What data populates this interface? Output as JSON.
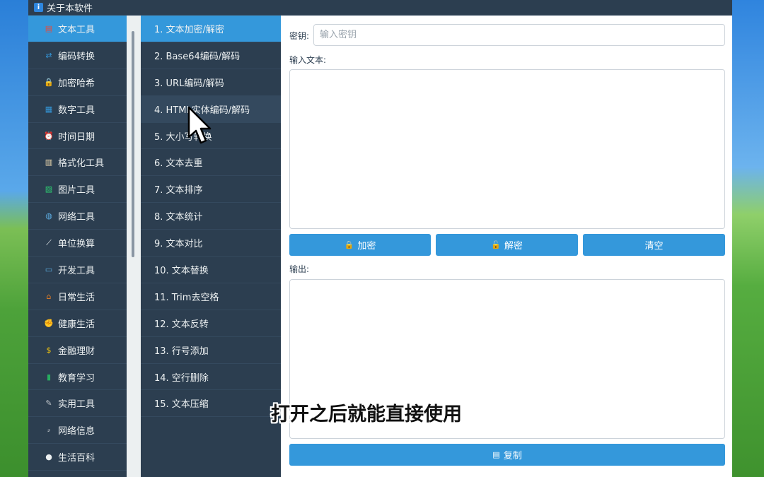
{
  "window": {
    "title": "关于本软件"
  },
  "categories": [
    {
      "label": "文本工具",
      "icon": "document-icon",
      "glyph": "▤",
      "color": "#e74c3c",
      "active": true
    },
    {
      "label": "编码转换",
      "icon": "convert-icon",
      "glyph": "⇄",
      "color": "#3498db"
    },
    {
      "label": "加密哈希",
      "icon": "lock-icon",
      "glyph": "🔒",
      "color": "#f1c40f"
    },
    {
      "label": "数字工具",
      "icon": "numbers-icon",
      "glyph": "▦",
      "color": "#3498db"
    },
    {
      "label": "时间日期",
      "icon": "alarm-clock-icon",
      "glyph": "⏰",
      "color": "#e74c3c"
    },
    {
      "label": "格式化工具",
      "icon": "clipboard-icon",
      "glyph": "▥",
      "color": "#f5deb3"
    },
    {
      "label": "图片工具",
      "icon": "image-icon",
      "glyph": "▨",
      "color": "#2ecc71"
    },
    {
      "label": "网络工具",
      "icon": "globe-icon",
      "glyph": "◍",
      "color": "#5dade2"
    },
    {
      "label": "单位换算",
      "icon": "ruler-icon",
      "glyph": "⟋",
      "color": "#ecf0f1"
    },
    {
      "label": "开发工具",
      "icon": "laptop-icon",
      "glyph": "▭",
      "color": "#5dade2"
    },
    {
      "label": "日常生活",
      "icon": "house-icon",
      "glyph": "⌂",
      "color": "#e67e22"
    },
    {
      "label": "健康生活",
      "icon": "muscle-icon",
      "glyph": "✊",
      "color": "#f1c40f"
    },
    {
      "label": "金融理财",
      "icon": "money-bag-icon",
      "glyph": "$",
      "color": "#f1c40f"
    },
    {
      "label": "教育学习",
      "icon": "books-icon",
      "glyph": "▮",
      "color": "#27ae60"
    },
    {
      "label": "实用工具",
      "icon": "tools-icon",
      "glyph": "✎",
      "color": "#bdc3c7"
    },
    {
      "label": "网络信息",
      "icon": "antenna-icon",
      "glyph": "⸗",
      "color": "#bdc3c7"
    },
    {
      "label": "生活百科",
      "icon": "bullet-icon",
      "glyph": "●",
      "color": "#ecf0f1"
    }
  ],
  "tools": [
    {
      "label": "1. 文本加密/解密",
      "active": true
    },
    {
      "label": "2. Base64编码/解码"
    },
    {
      "label": "3. URL编码/解码"
    },
    {
      "label": "4. HTML实体编码/解码",
      "hover": true
    },
    {
      "label": "5. 大小写转换"
    },
    {
      "label": "6. 文本去重"
    },
    {
      "label": "7. 文本排序"
    },
    {
      "label": "8. 文本统计"
    },
    {
      "label": "9. 文本对比"
    },
    {
      "label": "10. 文本替换"
    },
    {
      "label": "11. Trim去空格"
    },
    {
      "label": "12. 文本反转"
    },
    {
      "label": "13. 行号添加"
    },
    {
      "label": "14. 空行删除"
    },
    {
      "label": "15. 文本压缩"
    }
  ],
  "main": {
    "key_label": "密钥:",
    "key_placeholder": "输入密钥",
    "key_value": "",
    "input_label": "输入文本:",
    "input_value": "",
    "encrypt_label": "加密",
    "decrypt_label": "解密",
    "clear_label": "清空",
    "output_label": "输出:",
    "output_value": "",
    "copy_label": "复制"
  },
  "subtitle": "打开之后就能直接使用",
  "colors": {
    "sidebar_bg": "#2c3e50",
    "accent": "#3498db",
    "text_light": "#ecf0f1"
  }
}
